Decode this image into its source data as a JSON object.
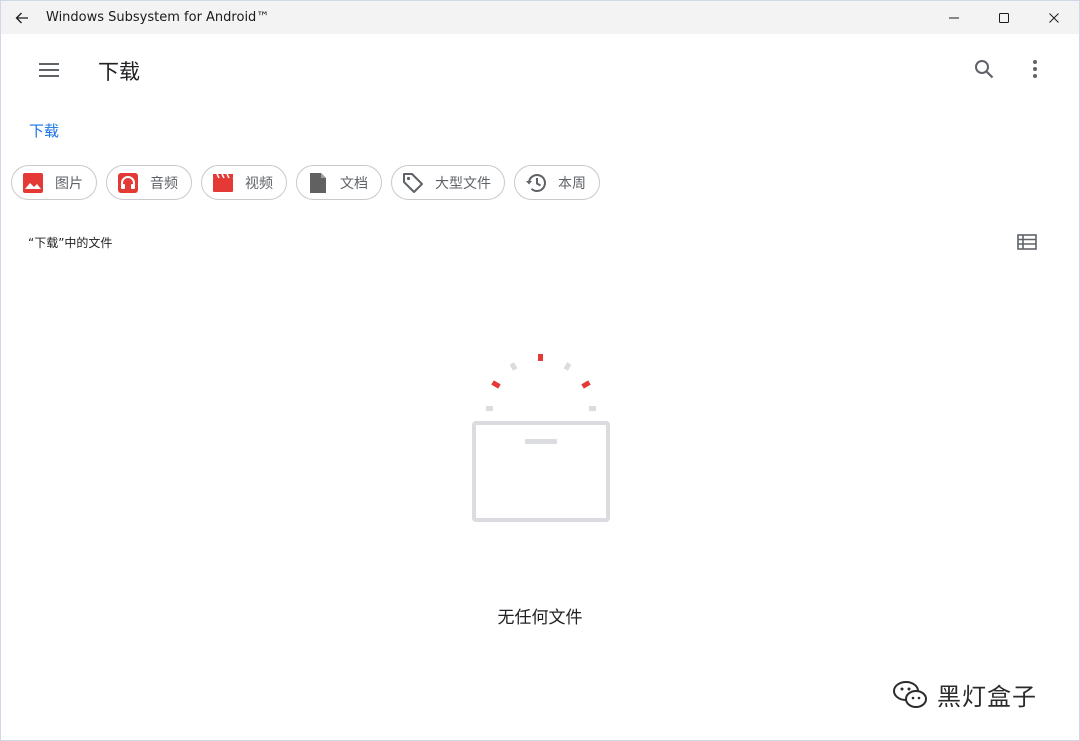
{
  "window": {
    "title": "Windows Subsystem for Android™",
    "controls": [
      "minimize",
      "maximize",
      "close"
    ]
  },
  "appbar": {
    "title": "下载",
    "icons": {
      "menu": "menu-icon",
      "search": "search-icon",
      "more": "more-vert-icon"
    }
  },
  "breadcrumb": {
    "current": "下载"
  },
  "chips": [
    {
      "label": "图片",
      "icon": "image-icon",
      "color": "#e53935"
    },
    {
      "label": "音频",
      "icon": "headphones-icon",
      "color": "#e53935"
    },
    {
      "label": "视频",
      "icon": "movie-icon",
      "color": "#e53935"
    },
    {
      "label": "文档",
      "icon": "document-icon",
      "color": "#616161"
    },
    {
      "label": "大型文件",
      "icon": "tag-icon",
      "color": "#5f6368"
    },
    {
      "label": "本周",
      "icon": "history-icon",
      "color": "#5f6368"
    }
  ],
  "section": {
    "label": "“下载”中的文件",
    "view_icon": "list-view-icon"
  },
  "empty_state": {
    "message": "无任何文件"
  },
  "watermark": {
    "text": "黑灯盒子"
  },
  "colors": {
    "accent": "#1a73e8",
    "chip_red": "#e53935",
    "titlebar": "#f3f3f3",
    "illustration_gray": "#dadce0"
  }
}
